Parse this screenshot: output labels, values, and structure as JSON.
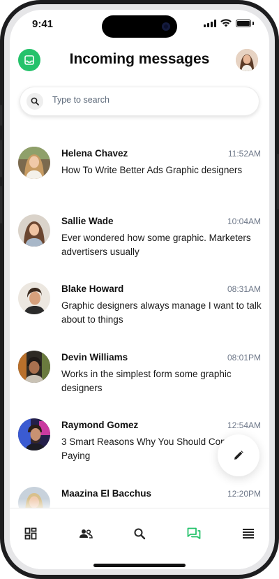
{
  "status_bar": {
    "time": "9:41"
  },
  "header": {
    "title": "Incoming messages"
  },
  "search": {
    "placeholder": "Type to search"
  },
  "messages": [
    {
      "name": "Helena Chavez",
      "time": "11:52AM",
      "text": "How To Write Better Ads Graphic designers"
    },
    {
      "name": "Sallie Wade",
      "time": "10:04AM",
      "text": "Ever wondered how some graphic. Marketers advertisers usually"
    },
    {
      "name": "Blake Howard",
      "time": "08:31AM",
      "text": "Graphic designers always manage I want to talk about to things"
    },
    {
      "name": "Devin Williams",
      "time": "08:01PM",
      "text": "Works in the simplest form some graphic designers"
    },
    {
      "name": "Raymond Gomez",
      "time": "12:54AM",
      "text": "3 Smart Reasons Why You Should Consider Paying"
    },
    {
      "name": "Maazina El Bacchus",
      "time": "12:20PM",
      "text": ""
    }
  ],
  "nav": [
    {
      "name": "dashboard-icon",
      "active": false
    },
    {
      "name": "contacts-icon",
      "active": false
    },
    {
      "name": "search-icon",
      "active": false
    },
    {
      "name": "messages-icon",
      "active": true
    },
    {
      "name": "menu-icon",
      "active": false
    }
  ],
  "colors": {
    "accent": "#25c26b",
    "nav_icon": "#222222",
    "time_text": "#6d7788"
  }
}
